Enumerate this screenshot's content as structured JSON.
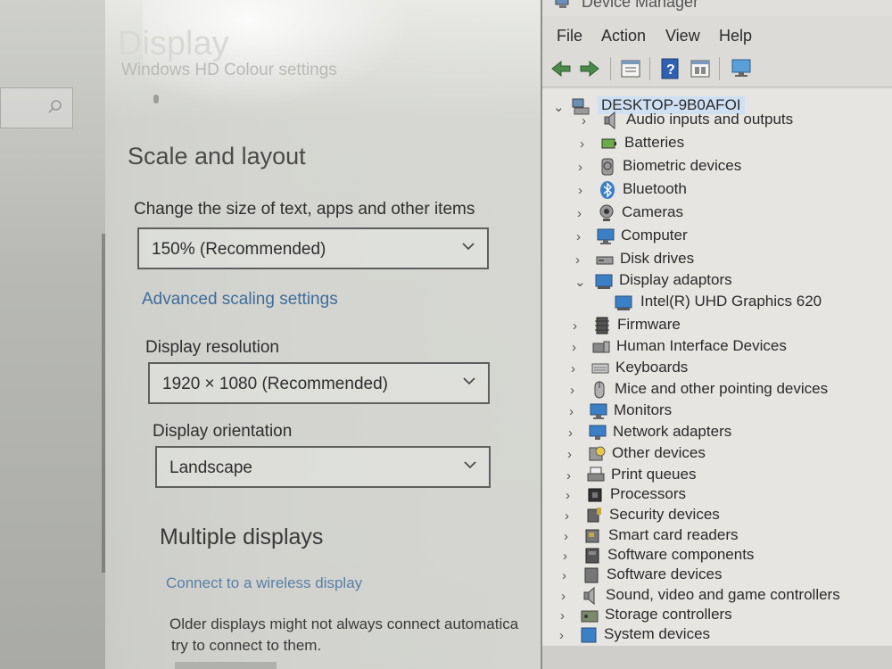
{
  "settings": {
    "title": "Display",
    "header_subtitle": "Windows HD Colour settings",
    "scale_layout": {
      "heading": "Scale and layout",
      "size_label": "Change the size of text, apps and other items",
      "size_value": "150% (Recommended)",
      "advanced_link": "Advanced scaling settings",
      "resolution_label": "Display resolution",
      "resolution_value": "1920 × 1080 (Recommended)",
      "orientation_label": "Display orientation",
      "orientation_value": "Landscape"
    },
    "multiple_displays": {
      "heading": "Multiple displays",
      "wireless_link": "Connect to a wireless display",
      "note_line1": "Older displays might not always connect automatica",
      "note_line2": "try to connect to them."
    }
  },
  "device_manager": {
    "title": "Device Manager",
    "menu": [
      "File",
      "Action",
      "View",
      "Help"
    ],
    "root": "DESKTOP-9B0AFOI",
    "categories": [
      {
        "label": "Audio inputs and outputs",
        "icon": "speaker-icon",
        "expanded": false
      },
      {
        "label": "Batteries",
        "icon": "battery-icon",
        "expanded": false
      },
      {
        "label": "Biometric devices",
        "icon": "fingerprint-icon",
        "expanded": false
      },
      {
        "label": "Bluetooth",
        "icon": "bluetooth-icon",
        "expanded": false
      },
      {
        "label": "Cameras",
        "icon": "camera-icon",
        "expanded": false
      },
      {
        "label": "Computer",
        "icon": "monitor-icon",
        "expanded": false
      },
      {
        "label": "Disk drives",
        "icon": "disk-icon",
        "expanded": false
      },
      {
        "label": "Display adaptors",
        "icon": "display-adapter-icon",
        "expanded": true,
        "children": [
          "Intel(R) UHD Graphics 620"
        ]
      },
      {
        "label": "Firmware",
        "icon": "firmware-icon",
        "expanded": false
      },
      {
        "label": "Human Interface Devices",
        "icon": "hid-icon",
        "expanded": false
      },
      {
        "label": "Keyboards",
        "icon": "keyboard-icon",
        "expanded": false
      },
      {
        "label": "Mice and other pointing devices",
        "icon": "mouse-icon",
        "expanded": false
      },
      {
        "label": "Monitors",
        "icon": "monitor-icon",
        "expanded": false
      },
      {
        "label": "Network adapters",
        "icon": "network-icon",
        "expanded": false
      },
      {
        "label": "Other devices",
        "icon": "unknown-device-icon",
        "expanded": false
      },
      {
        "label": "Print queues",
        "icon": "printer-icon",
        "expanded": false
      },
      {
        "label": "Processors",
        "icon": "processor-icon",
        "expanded": false
      },
      {
        "label": "Security devices",
        "icon": "security-icon",
        "expanded": false
      },
      {
        "label": "Smart card readers",
        "icon": "smartcard-icon",
        "expanded": false
      },
      {
        "label": "Software components",
        "icon": "software-component-icon",
        "expanded": false
      },
      {
        "label": "Software devices",
        "icon": "software-device-icon",
        "expanded": false
      },
      {
        "label": "Sound, video and game controllers",
        "icon": "speaker-icon",
        "expanded": false
      },
      {
        "label": "Storage controllers",
        "icon": "storage-icon",
        "expanded": false
      },
      {
        "label": "System devices",
        "icon": "system-icon",
        "expanded": false
      }
    ]
  },
  "colors": {
    "link": "#3f6c99",
    "root_highlight": "#cfe0f3",
    "device_blue": "#3b7fc4"
  }
}
